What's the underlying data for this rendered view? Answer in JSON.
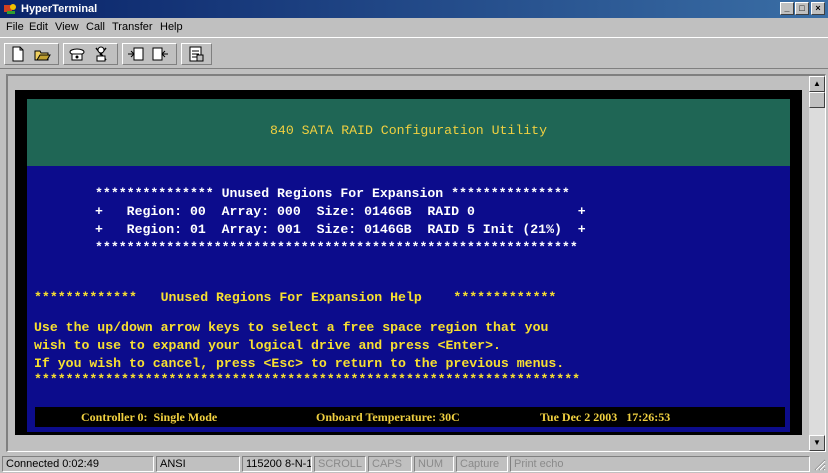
{
  "window": {
    "title": "HyperTerminal",
    "minimize_glyph": "_",
    "maximize_glyph": "□",
    "close_glyph": "×"
  },
  "menu": [
    "File",
    "Edit",
    "View",
    "Call",
    "Transfer",
    "Help"
  ],
  "toolbar_icons": [
    "new-document-icon",
    "open-folder-icon",
    "call-phone-icon",
    "disconnect-icon",
    "send-file-icon",
    "receive-file-icon",
    "properties-icon"
  ],
  "terminal": {
    "header_title": "840 SATA RAID Configuration Utility",
    "regions_heading": "*************** Unused Regions For Expansion ***************",
    "regions": [
      "+   Region: 00  Array: 000  Size: 0146GB  RAID 0             +",
      "+   Region: 01  Array: 001  Size: 0146GB  RAID 5 Init (21%)  +"
    ],
    "regions_footer": "*************************************************************",
    "help_heading": "*************   Unused Regions For Expansion Help    *************",
    "help_lines": [
      "Use the up/down arrow keys to select a free space region that you",
      "wish to use to expand your logical drive and press <Enter>.",
      "If you wish to cancel, press <Esc> to return to the previous menus.",
      "*********************************************************************"
    ],
    "status": {
      "controller": "Controller 0:  Single Mode",
      "temperature": "Onboard Temperature: 30C",
      "datetime": "Tue Dec 2 2003   17:26:53"
    }
  },
  "statusbar": {
    "connected": "Connected 0:02:49",
    "emulation": "ANSI",
    "settings": "115200 8-N-1",
    "scroll": "SCROLL",
    "caps": "CAPS",
    "num": "NUM",
    "capture": "Capture",
    "print_echo": "Print echo"
  },
  "colors": {
    "header_band": "#1f6655",
    "panel": "#0c0c8c",
    "text_yellow": "#f8e030",
    "text_white": "#ffffff"
  }
}
